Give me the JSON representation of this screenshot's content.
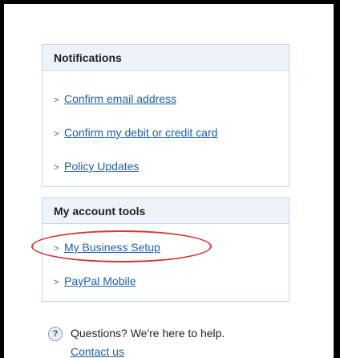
{
  "notifications": {
    "title": "Notifications",
    "items": [
      {
        "label": "Confirm email address"
      },
      {
        "label": "Confirm my debit or credit card"
      },
      {
        "label": "Policy Updates"
      }
    ]
  },
  "tools": {
    "title": "My account tools",
    "items": [
      {
        "label": "My Business Setup"
      },
      {
        "label": "PayPal Mobile"
      }
    ]
  },
  "help": {
    "icon": "?",
    "text": "Questions? We're here to help.",
    "contact_label": "Contact us"
  },
  "colors": {
    "link": "#1f5fa7",
    "panel_header_bg": "#eef3fa",
    "panel_border": "#c6d6e8",
    "highlight": "#d43737"
  }
}
